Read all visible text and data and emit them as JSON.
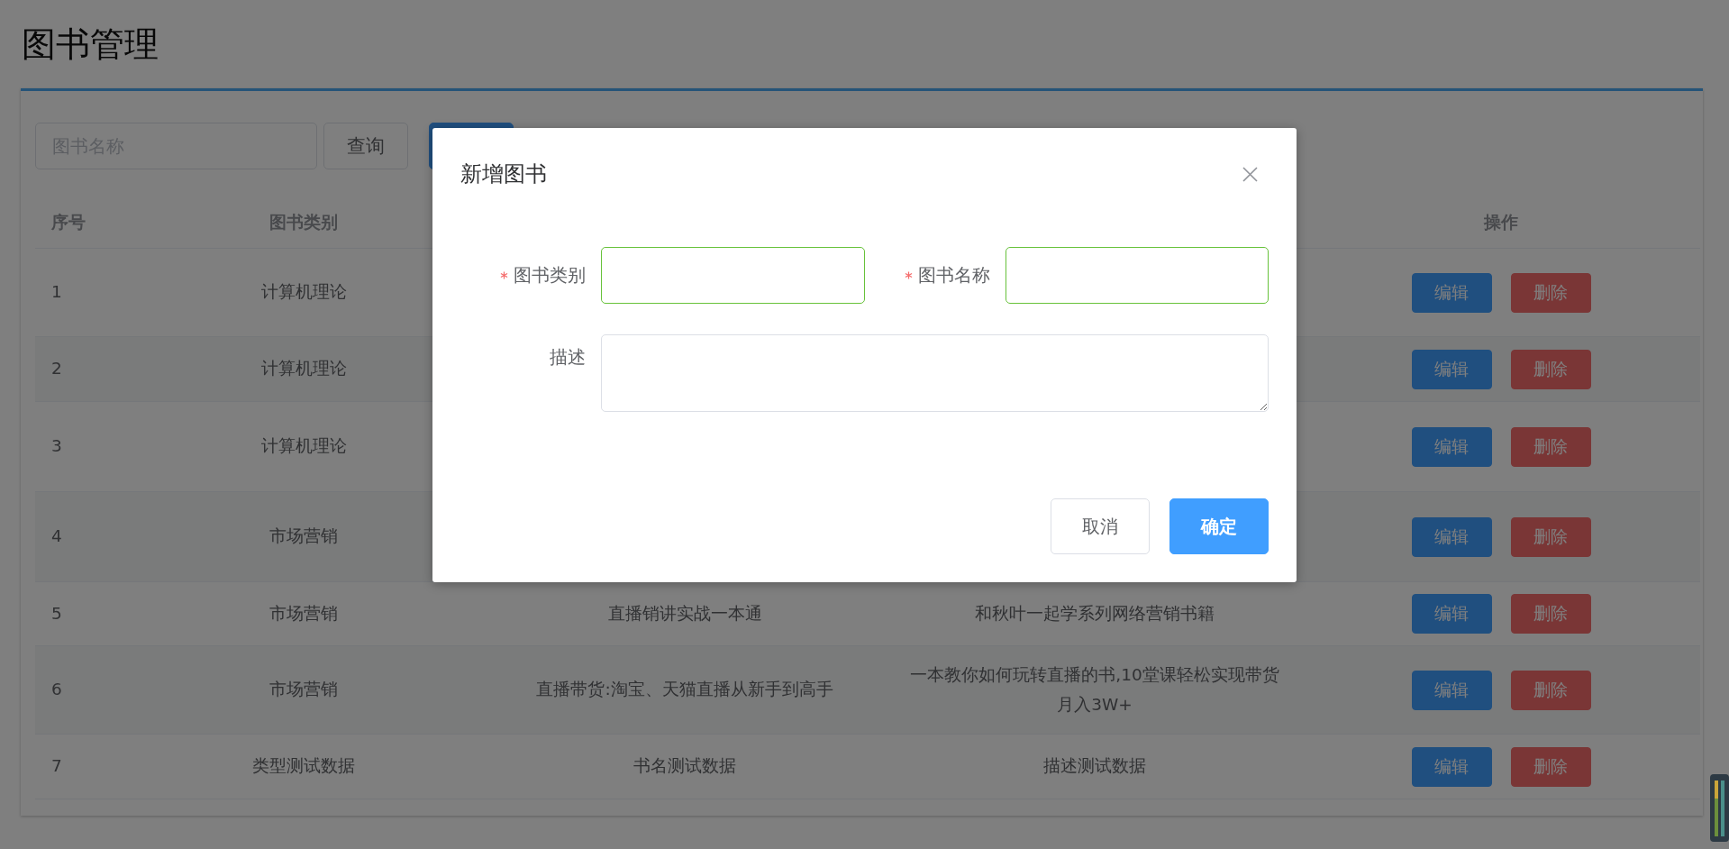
{
  "page": {
    "title": "图书管理"
  },
  "toolbar": {
    "search": {
      "placeholder": "图书名称"
    },
    "buttons": [
      {
        "label": "查询",
        "kind": "default"
      },
      {
        "kind": "primary"
      }
    ]
  },
  "table": {
    "columns": {
      "column_1": "序号",
      "column_2": "图书类别",
      "column_5": "操作"
    },
    "rows": [
      {
        "column_1": "1",
        "column_2": "计算机理论",
        "actions": [
          {
            "label": "编辑",
            "kind": "primary"
          },
          {
            "label": "删除",
            "kind": "danger"
          }
        ]
      },
      {
        "column_1": "2",
        "column_2": "计算机理论",
        "actions": [
          {
            "label": "编辑",
            "kind": "primary"
          },
          {
            "label": "删除",
            "kind": "danger"
          }
        ]
      },
      {
        "column_1": "3",
        "column_2": "计算机理论",
        "actions": [
          {
            "label": "编辑",
            "kind": "primary"
          },
          {
            "label": "删除",
            "kind": "danger"
          }
        ]
      },
      {
        "column_1": "4",
        "column_2": "市场营销",
        "actions": [
          {
            "label": "编辑",
            "kind": "primary"
          },
          {
            "label": "删除",
            "kind": "danger"
          }
        ]
      },
      {
        "column_1": "5",
        "column_2": "市场营销",
        "column_3": "直播销讲实战一本通",
        "column_4": "和秋叶一起学系列网络营销书籍",
        "actions": [
          {
            "label": "编辑",
            "kind": "primary"
          },
          {
            "label": "删除",
            "kind": "danger"
          }
        ]
      },
      {
        "column_1": "6",
        "column_2": "市场营销",
        "column_3": "直播带货:淘宝、天猫直播从新手到高手",
        "column_4": "一本教你如何玩转直播的书,10堂课轻松实现带货月入3W+",
        "actions": [
          {
            "label": "编辑",
            "kind": "primary"
          },
          {
            "label": "删除",
            "kind": "danger"
          }
        ]
      },
      {
        "column_1": "7",
        "column_2": "类型测试数据",
        "column_3": "书名测试数据",
        "column_4": "描述测试数据",
        "actions": [
          {
            "label": "编辑",
            "kind": "primary"
          },
          {
            "label": "删除",
            "kind": "danger"
          }
        ]
      }
    ]
  },
  "dialog": {
    "title": "新增图书",
    "fields": [
      {
        "label": "图书类别",
        "kind": "input",
        "required": true,
        "valid": true
      },
      {
        "label": "图书名称",
        "kind": "input",
        "required": true,
        "valid": true
      },
      {
        "label": "描述",
        "kind": "textarea",
        "required": false
      }
    ],
    "buttons": [
      {
        "label": "取消",
        "kind": "default"
      },
      {
        "label": "确定",
        "kind": "primary"
      }
    ]
  }
}
